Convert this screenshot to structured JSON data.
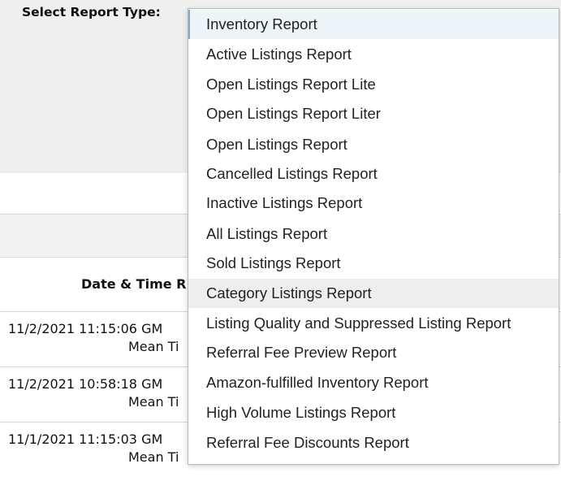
{
  "form": {
    "select_label": "Select Report Type:"
  },
  "table": {
    "column_header": "Date & Time R",
    "rows": [
      {
        "line1": "11/2/2021 11:15:06 GM",
        "line2": "Mean Ti"
      },
      {
        "line1": "11/2/2021 10:58:18 GM",
        "line2": "Mean Ti"
      },
      {
        "line1": "11/1/2021 11:15:03 GM",
        "line2": "Mean Ti"
      }
    ]
  },
  "dropdown": {
    "selected_value": "Inventory Report",
    "hovered_value": "Category Listings Report",
    "options": [
      "Inventory Report",
      "Active Listings Report",
      "Open Listings Report Lite",
      "Open Listings Report Liter",
      "Open Listings Report",
      "Cancelled Listings Report",
      "Inactive Listings Report",
      "All Listings Report",
      "Sold Listings Report",
      "Category Listings Report",
      "Listing Quality and Suppressed Listing Report",
      "Referral Fee Preview Report",
      "Amazon-fulfilled Inventory Report",
      "High Volume Listings Report",
      "Referral Fee Discounts Report"
    ]
  },
  "colors": {
    "selected_bg": "#edf5f8",
    "selected_border": "#7fa9c4",
    "hover_bg": "#eeeeee"
  }
}
